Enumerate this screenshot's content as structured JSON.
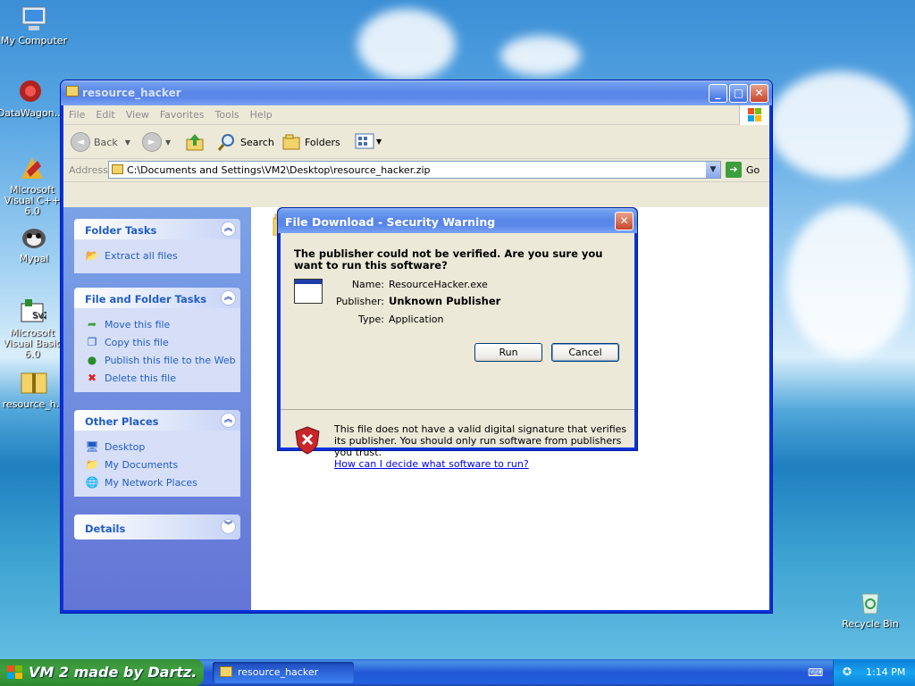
{
  "desktop": {
    "icons": [
      {
        "label": "My Computer"
      },
      {
        "label": "DataWagon..."
      },
      {
        "label": "Microsoft Visual C++ 6.0"
      },
      {
        "label": "Mypal"
      },
      {
        "label": "Microsoft Visual Basic 6.0"
      },
      {
        "label": "resource_h..."
      },
      {
        "label": "Recycle Bin"
      }
    ]
  },
  "explorer": {
    "title": "resource_hacker",
    "menu": [
      "File",
      "Edit",
      "View",
      "Favorites",
      "Tools",
      "Help"
    ],
    "toolbar": {
      "back": "Back",
      "search": "Search",
      "folders": "Folders"
    },
    "address": {
      "label": "Address",
      "value": "C:\\Documents and Settings\\VM2\\Desktop\\resource_hacker.zip",
      "go": "Go"
    },
    "panels": {
      "folder_tasks": {
        "title": "Folder Tasks",
        "items": [
          "Extract all files"
        ]
      },
      "file_folder_tasks": {
        "title": "File and Folder Tasks",
        "items": [
          "Move this file",
          "Copy this file",
          "Publish this file to the Web",
          "Delete this file"
        ]
      },
      "other_places": {
        "title": "Other Places",
        "items": [
          "Desktop",
          "My Documents",
          "My Network Places"
        ]
      },
      "details": {
        "title": "Details"
      }
    }
  },
  "dialog": {
    "title": "File Download - Security Warning",
    "question": "The publisher could not be verified.  Are you sure you want to run this software?",
    "name_label": "Name:",
    "name_value": "ResourceHacker.exe",
    "publisher_label": "Publisher:",
    "publisher_value": "Unknown Publisher",
    "type_label": "Type:",
    "type_value": "Application",
    "run": "Run",
    "cancel": "Cancel",
    "warning": "This file does not have a valid digital signature that verifies its publisher.  You should only run software from publishers you trust.",
    "link": "How can I decide what software to run?"
  },
  "taskbar": {
    "start": "VM 2 made by Dartz.",
    "task": "resource_hacker",
    "clock": "1:14 PM"
  },
  "colors": {
    "xp_blue": "#0831d9",
    "panel_text": "#215dc6",
    "start_green": "#3ea03e"
  }
}
